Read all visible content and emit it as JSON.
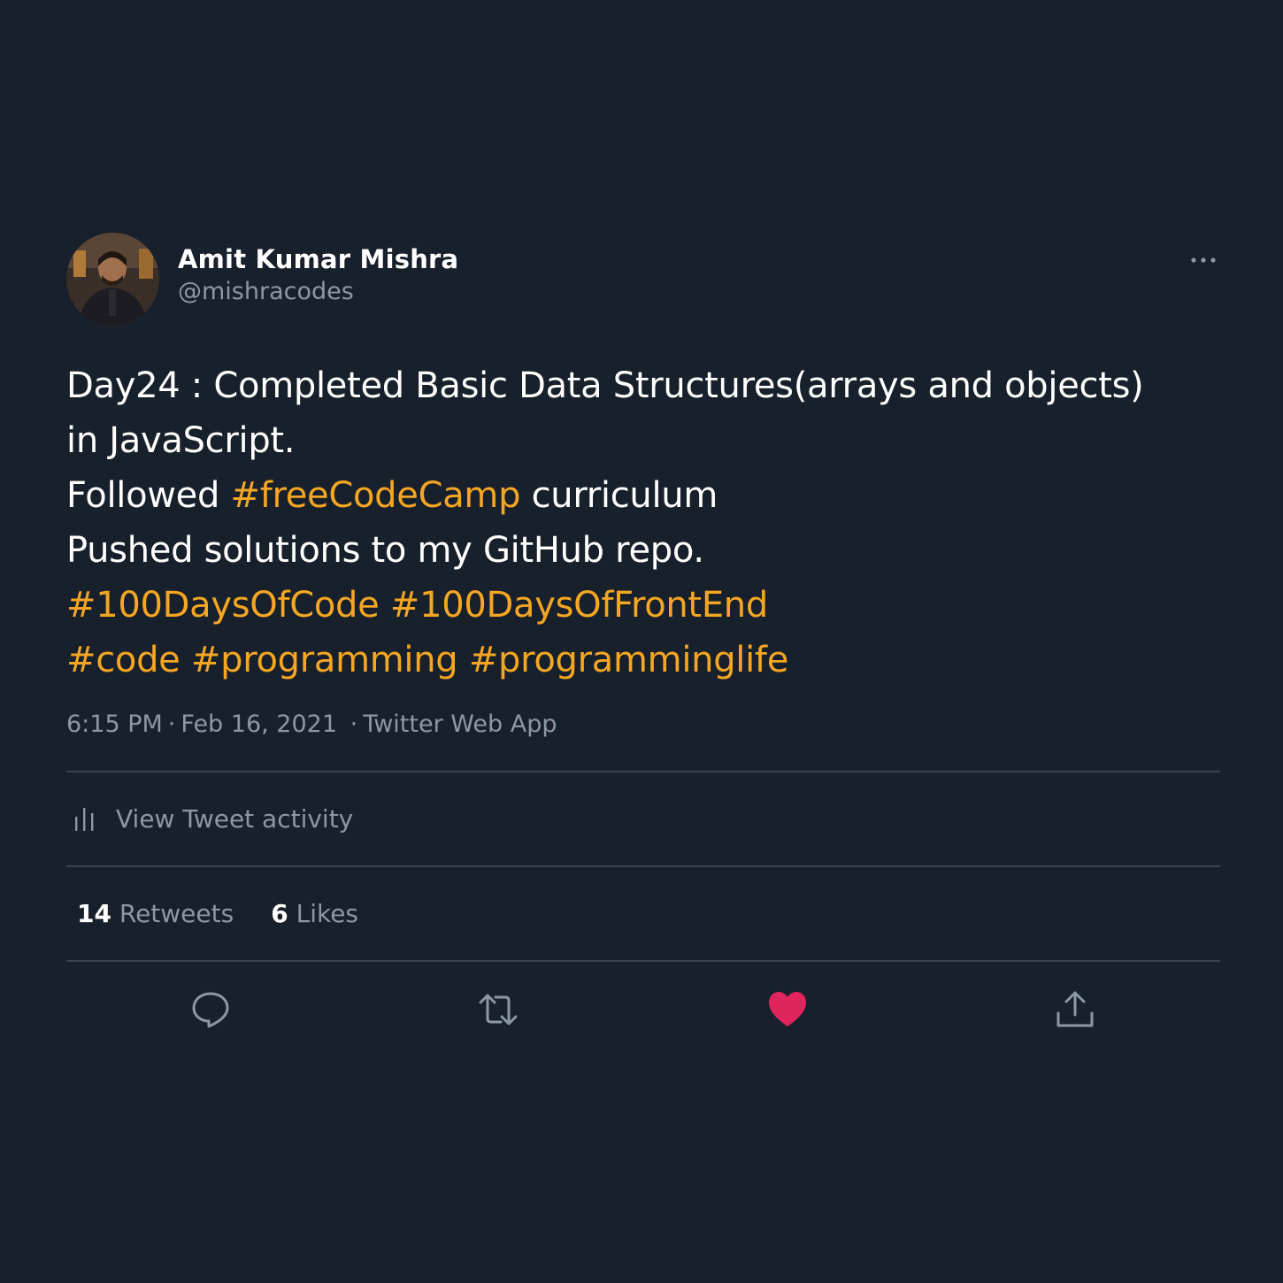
{
  "author": {
    "display_name": "Amit Kumar Mishra",
    "handle": "@mishracodes"
  },
  "tweet": {
    "lines": [
      [
        {
          "text": "Day24 : Completed Basic Data Structures(arrays and objects)",
          "hashtag": false
        }
      ],
      [
        {
          "text": "in JavaScript.",
          "hashtag": false
        }
      ],
      [
        {
          "text": "Followed ",
          "hashtag": false
        },
        {
          "text": "#freeCodeCamp",
          "hashtag": true
        },
        {
          "text": " curriculum",
          "hashtag": false
        }
      ],
      [
        {
          "text": "Pushed solutions to my GitHub repo.",
          "hashtag": false
        }
      ],
      [
        {
          "text": "#100DaysOfCode",
          "hashtag": true
        },
        {
          "text": " ",
          "hashtag": false
        },
        {
          "text": "#100DaysOfFrontEnd",
          "hashtag": true
        }
      ],
      [
        {
          "text": "#code",
          "hashtag": true
        },
        {
          "text": " ",
          "hashtag": false
        },
        {
          "text": "#programming",
          "hashtag": true
        },
        {
          "text": " ",
          "hashtag": false
        },
        {
          "text": "#programminglife",
          "hashtag": true
        }
      ]
    ],
    "time": "6:15 PM",
    "date": "Feb 16, 2021",
    "source": "Twitter Web App",
    "separator": "·"
  },
  "activity": {
    "label": "View Tweet activity"
  },
  "stats": {
    "retweets_count": "14",
    "retweets_label": "Retweets",
    "likes_count": "6",
    "likes_label": "Likes"
  },
  "icons": {
    "more": "more-horizontal-icon",
    "activity": "bar-chart-icon",
    "reply": "reply-bubble-icon",
    "retweet": "retweet-icon",
    "like": "heart-icon",
    "share": "share-upload-icon"
  },
  "colors": {
    "background": "#18202b",
    "hashtag": "#f5a623",
    "muted": "#8b98a5",
    "divider": "#38444d",
    "like_active": "#e0245e"
  }
}
